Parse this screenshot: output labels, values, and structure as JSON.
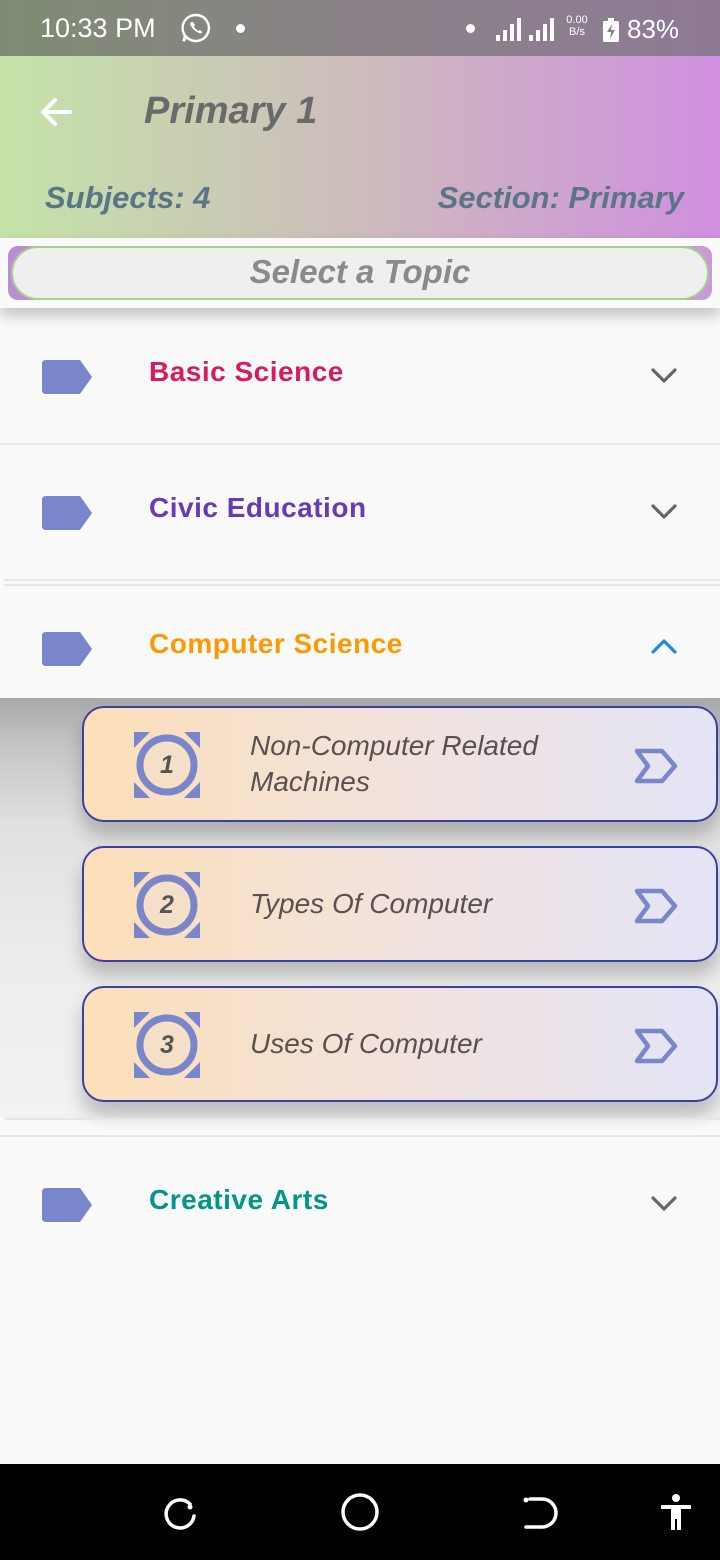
{
  "status_bar": {
    "time": "10:33 PM",
    "net_speed_value": "0.00",
    "net_speed_unit": "B/s",
    "battery": "83%",
    "icons": [
      "whatsapp-icon",
      "signal-icon",
      "battery-charging-icon"
    ]
  },
  "header": {
    "title": "Primary 1",
    "subjects": "Subjects: 4",
    "section": "Section: Primary",
    "back_icon": "arrow-left-icon"
  },
  "search": {
    "placeholder": "Select a Topic"
  },
  "subjects": [
    {
      "label": "Basic Science",
      "color": "#d81b60",
      "expanded": false
    },
    {
      "label": "Civic Education",
      "color": "#673ab7",
      "expanded": false
    },
    {
      "label": "Computer Science",
      "color": "#ff9800",
      "expanded": true,
      "topics": [
        {
          "number": "1",
          "title_line1": "Non-Computer Related",
          "title_line2": "Machines"
        },
        {
          "number": "2",
          "title_line1": "Types Of Computer",
          "title_line2": ""
        },
        {
          "number": "3",
          "title_line1": "Uses Of Computer",
          "title_line2": ""
        }
      ]
    },
    {
      "label": "Creative Arts",
      "color": "#009688",
      "expanded": false
    }
  ],
  "colors": {
    "tag": "#7986cb",
    "chevron": "#666666",
    "chevron_active": "#1e88e5",
    "card_border": "#3a3fa0"
  },
  "nav_icons": [
    "recent-apps-icon",
    "home-icon",
    "back-nav-icon",
    "accessibility-icon"
  ]
}
